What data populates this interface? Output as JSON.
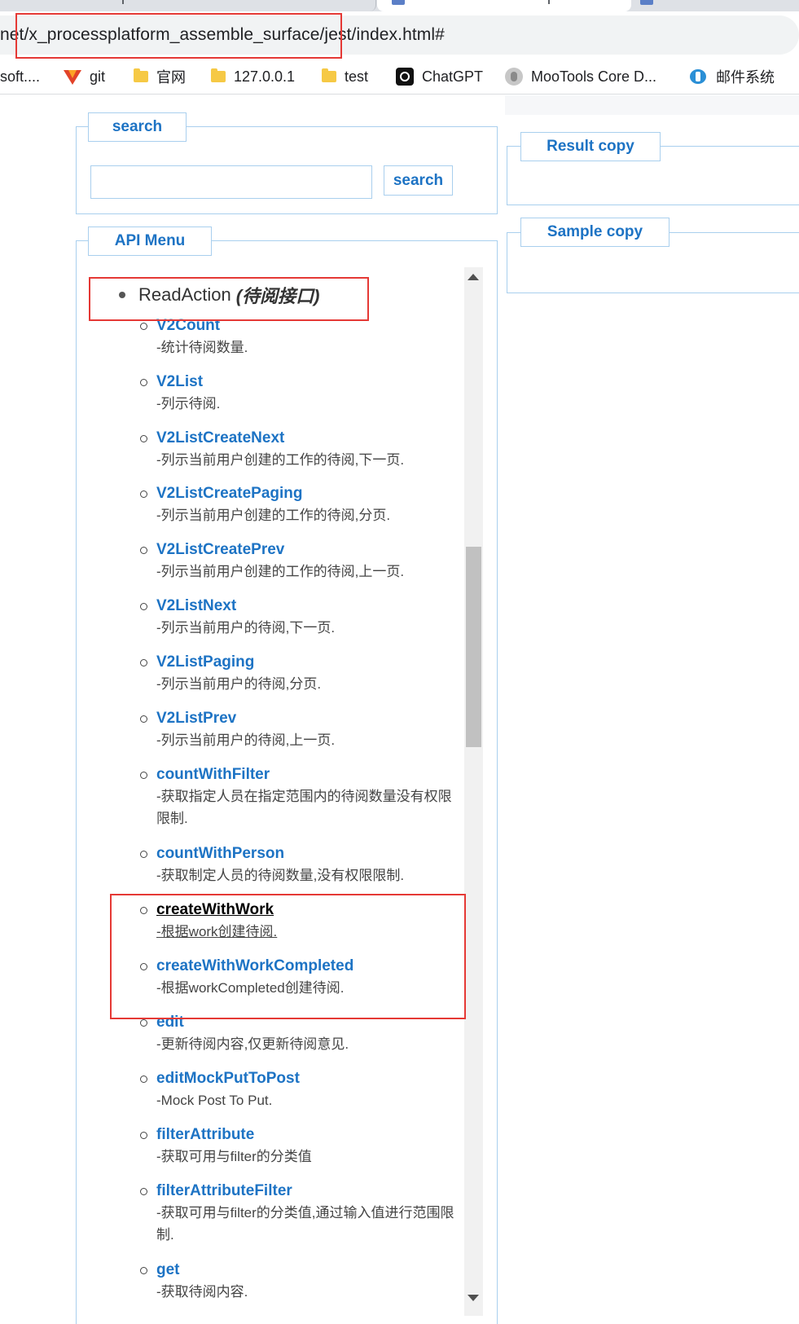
{
  "browser": {
    "url": "net/x_processplatform_assemble_surface/jest/index.html#",
    "bookmarks": [
      {
        "label": "soft....",
        "icon": "none"
      },
      {
        "label": "git",
        "icon": "gitlab-icon"
      },
      {
        "label": "官网",
        "icon": "folder-icon"
      },
      {
        "label": "127.0.0.1",
        "icon": "folder-icon"
      },
      {
        "label": "test",
        "icon": "folder-icon"
      },
      {
        "label": "ChatGPT",
        "icon": "chatgpt-icon"
      },
      {
        "label": "MooTools Core D...",
        "icon": "mootools-icon"
      },
      {
        "label": "邮件系统",
        "icon": "mail-icon"
      }
    ]
  },
  "search": {
    "legend": "search",
    "input_value": "",
    "button_label": "search"
  },
  "result": {
    "legend": "Result copy"
  },
  "sample": {
    "legend": "Sample copy"
  },
  "api_menu": {
    "legend": "API Menu",
    "group": {
      "name": "ReadAction",
      "cn": "(待阅接口)"
    },
    "items": [
      {
        "name": "V2Count",
        "desc": "-统计待阅数量."
      },
      {
        "name": "V2List",
        "desc": "-列示待阅."
      },
      {
        "name": "V2ListCreateNext",
        "desc": "-列示当前用户创建的工作的待阅,下一页."
      },
      {
        "name": "V2ListCreatePaging",
        "desc": "-列示当前用户创建的工作的待阅,分页."
      },
      {
        "name": "V2ListCreatePrev",
        "desc": "-列示当前用户创建的工作的待阅,上一页."
      },
      {
        "name": "V2ListNext",
        "desc": "-列示当前用户的待阅,下一页."
      },
      {
        "name": "V2ListPaging",
        "desc": "-列示当前用户的待阅,分页."
      },
      {
        "name": "V2ListPrev",
        "desc": "-列示当前用户的待阅,上一页."
      },
      {
        "name": "countWithFilter",
        "desc": "-获取指定人员在指定范围内的待阅数量没有权限限制."
      },
      {
        "name": "countWithPerson",
        "desc": "-获取制定人员的待阅数量,没有权限限制."
      },
      {
        "name": "createWithWork",
        "desc": "-根据work创建待阅."
      },
      {
        "name": "createWithWorkCompleted",
        "desc": "-根据workCompleted创建待阅."
      },
      {
        "name": "edit",
        "desc": "-更新待阅内容,仅更新待阅意见."
      },
      {
        "name": "editMockPutToPost",
        "desc": "-Mock Post To Put."
      },
      {
        "name": "filterAttribute",
        "desc": "-获取可用与filter的分类值"
      },
      {
        "name": "filterAttributeFilter",
        "desc": "-获取可用与filter的分类值,通过输入值进行范围限制."
      },
      {
        "name": "get",
        "desc": "-获取待阅内容."
      }
    ]
  },
  "colors": {
    "accent": "#1d73c4",
    "border": "#a9cfee",
    "highlight": "#e53935"
  }
}
